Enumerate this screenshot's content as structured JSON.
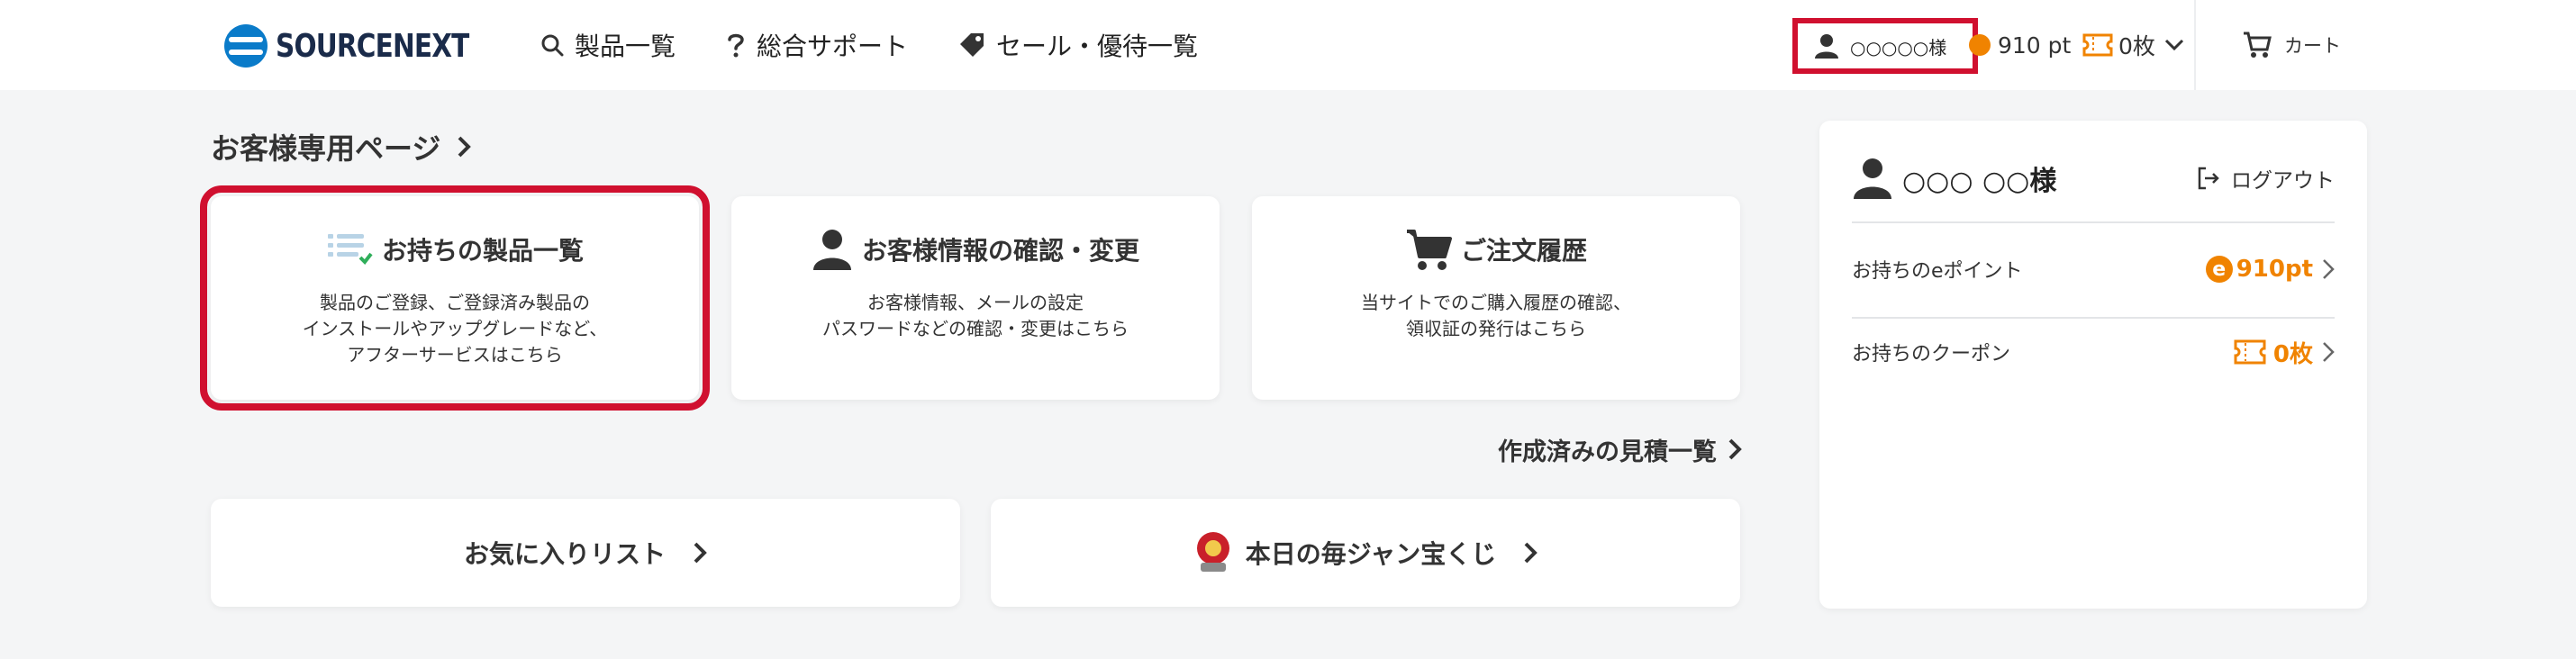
{
  "header": {
    "brand": "SOURCENEXT",
    "nav": [
      {
        "label": "製品一覧",
        "icon": "search-icon"
      },
      {
        "label": "総合サポート",
        "icon": "question-icon"
      },
      {
        "label": "セール・優待一覧",
        "icon": "tag-icon"
      }
    ],
    "account_name": "○○○○○様",
    "points": "910 pt",
    "coupons": "0枚",
    "cart_label": "カート",
    "highlight_color": "#d0102f"
  },
  "main": {
    "page_title": "お客様専用ページ",
    "cards": [
      {
        "title": "お持ちの製品一覧",
        "icon": "product-list-icon",
        "desc": [
          "製品のご登録、ご登録済み製品の",
          "インストールやアップグレードなど、",
          "アフターサービスはこちら"
        ]
      },
      {
        "title": "お客様情報の確認・変更",
        "icon": "person-icon",
        "desc": [
          "お客様情報、メールの設定",
          "パスワードなどの確認・変更はこちら"
        ]
      },
      {
        "title": "ご注文履歴",
        "icon": "cart-icon",
        "desc": [
          "当サイトでのご購入履歴の確認、",
          "領収証の発行はこちら"
        ]
      }
    ],
    "estimate_link": "作成済みの見積一覧",
    "wishlist_label": "お気に入りリスト",
    "lottery_label": "本日の毎ジャン宝くじ"
  },
  "side": {
    "user_name": "○○○ ○○様",
    "logout_label": "ログアウト",
    "epoint_label": "お持ちのeポイント",
    "epoint_value": "910pt",
    "coupon_label": "お持ちのクーポン",
    "coupon_value": "0枚",
    "accent_color": "#f08300"
  }
}
